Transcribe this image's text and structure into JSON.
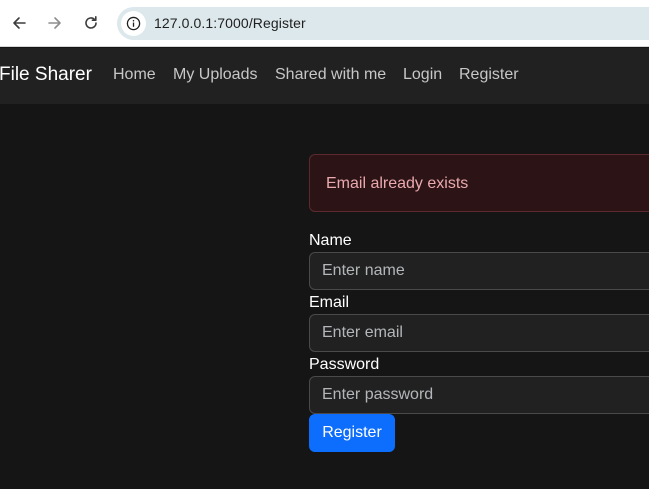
{
  "browser": {
    "url": "127.0.0.1:7000/Register",
    "back_icon": "arrow-left-icon",
    "forward_icon": "arrow-right-icon",
    "reload_icon": "reload-icon",
    "site_info_icon": "info-circle-icon"
  },
  "navbar": {
    "brand": "File Sharer",
    "links": [
      {
        "label": "Home"
      },
      {
        "label": "My Uploads"
      },
      {
        "label": "Shared with me"
      },
      {
        "label": "Login"
      },
      {
        "label": "Register"
      }
    ]
  },
  "alert": {
    "message": "Email already exists",
    "color": "#eaa9ae"
  },
  "form": {
    "name": {
      "label": "Name",
      "placeholder": "Enter name"
    },
    "email": {
      "label": "Email",
      "placeholder": "Enter email"
    },
    "password": {
      "label": "Password",
      "placeholder": "Enter password"
    },
    "submit_label": "Register"
  },
  "colors": {
    "page_bg": "#151515",
    "navbar_bg": "#212121",
    "primary": "#0d6efd"
  }
}
